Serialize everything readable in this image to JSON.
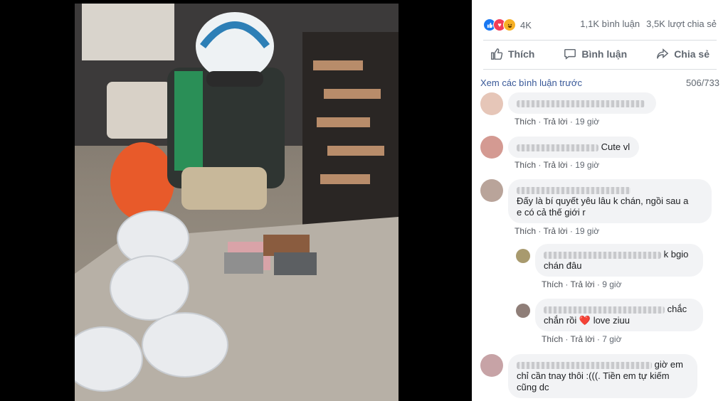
{
  "post": {
    "reaction_count": "4K",
    "comment_count": "1,1K bình luận",
    "share_count": "3,5K lượt chia sẻ",
    "colors": {
      "like": "#1877f2",
      "love": "#f33e58",
      "haha": "#f7b125",
      "link": "#385898",
      "muted": "#606770"
    }
  },
  "actions": {
    "like": "Thích",
    "comment": "Bình luận",
    "share": "Chia sẻ"
  },
  "comments_header": {
    "previous": "Xem các bình luận trước",
    "count": "506/733"
  },
  "comments": [
    {
      "text": "",
      "like": "Thích",
      "reply": "Trả lời",
      "time": "19 giờ"
    },
    {
      "text": "Cute vl",
      "like": "Thích",
      "reply": "Trả lời",
      "time": "19 giờ"
    },
    {
      "text_line1": "Đấy là bí quyết yêu lâu k chán, ngồi sau a",
      "text_line2": "e có cả thế giới r",
      "like": "Thích",
      "reply": "Trả lời",
      "time": "19 giờ"
    },
    {
      "text_line1": "k bgio",
      "text_line2": "chán đâu",
      "like": "Thích",
      "reply": "Trả lời",
      "time": "9 giờ"
    },
    {
      "text_line1": "chắc",
      "text_line2": "chắn rồi",
      "text_after_heart": "love ziuu",
      "like": "Thích",
      "reply": "Trả lời",
      "time": "7 giờ"
    },
    {
      "text_line1": "giờ em",
      "text_line2": "chỉ cần tnay thôi :(((. Tiền em tự kiếm",
      "text_line3": "cũng dc"
    }
  ]
}
